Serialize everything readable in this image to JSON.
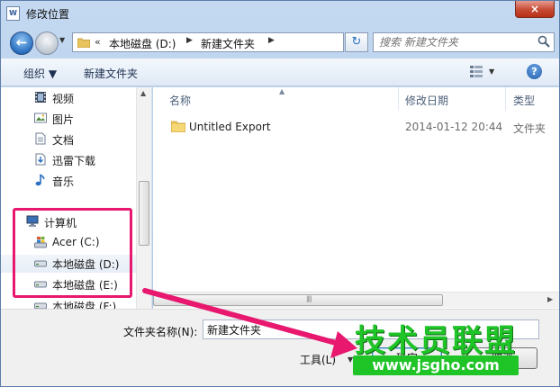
{
  "window": {
    "title": "修改位置",
    "app_icon": "W",
    "close_icon": "×"
  },
  "nav": {
    "back_icon": "←",
    "forward_icon": "→",
    "address": {
      "chevron": "«",
      "crumbs": [
        "本地磁盘 (D:)",
        "新建文件夹"
      ]
    },
    "search_placeholder": "搜索 新建文件夹"
  },
  "toolbar": {
    "organize": "组织",
    "new_folder": "新建文件夹"
  },
  "sidebar": {
    "items": [
      {
        "label": "视频",
        "icon": "video-icon"
      },
      {
        "label": "图片",
        "icon": "pictures-icon"
      },
      {
        "label": "文档",
        "icon": "documents-icon"
      },
      {
        "label": "迅雷下载",
        "icon": "download-icon"
      },
      {
        "label": "音乐",
        "icon": "music-icon"
      },
      {
        "label": "计算机",
        "icon": "computer-icon"
      },
      {
        "label": "Acer (C:)",
        "icon": "windows-drive-icon"
      },
      {
        "label": "本地磁盘 (D:)",
        "icon": "drive-icon"
      },
      {
        "label": "本地磁盘 (E:)",
        "icon": "drive-icon"
      },
      {
        "label": "本地磁盘 (F:)",
        "icon": "drive-icon"
      }
    ]
  },
  "file_list": {
    "columns": [
      "名称",
      "修改日期",
      "类型"
    ],
    "rows": [
      {
        "name": "Untitled Export",
        "modified": "2014-01-12 20:44",
        "type": "文件夹"
      }
    ]
  },
  "footer": {
    "folder_name_label": "文件夹名称(N):",
    "folder_name_value": "新建文件夹",
    "tools_label": "工具(L)",
    "ok_label": "确定",
    "cancel_label": "取消"
  },
  "watermark": {
    "title": "技术员联盟",
    "url": "www.jsgho.com"
  },
  "colors": {
    "highlight": "#e8186f",
    "watermark": "#1fc427"
  }
}
